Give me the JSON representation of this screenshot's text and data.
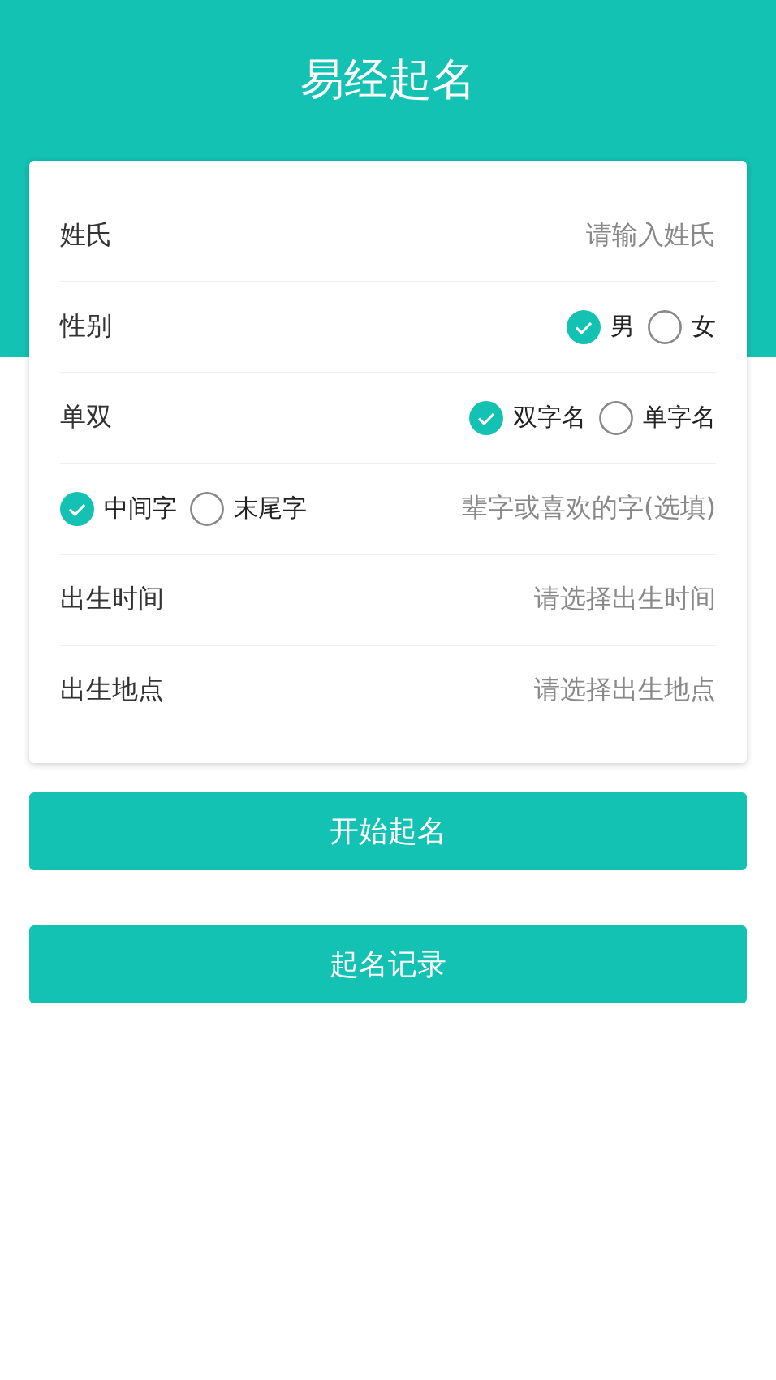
{
  "header": {
    "title": "易经起名"
  },
  "form": {
    "rows": [
      {
        "kind": "input",
        "label": "姓氏",
        "placeholder": "请输入姓氏"
      },
      {
        "kind": "radio",
        "label": "性别",
        "options": [
          {
            "label": "男",
            "selected": true
          },
          {
            "label": "女",
            "selected": false
          }
        ]
      },
      {
        "kind": "radio",
        "label": "单双",
        "options": [
          {
            "label": "双字名",
            "selected": true
          },
          {
            "label": "单字名",
            "selected": false
          }
        ]
      },
      {
        "kind": "radio-input",
        "options": [
          {
            "label": "中间字",
            "selected": true
          },
          {
            "label": "末尾字",
            "selected": false
          }
        ],
        "placeholder": "辈字或喜欢的字(选填)"
      },
      {
        "kind": "picker",
        "label": "出生时间",
        "placeholder": "请选择出生时间"
      },
      {
        "kind": "picker",
        "label": "出生地点",
        "placeholder": "请选择出生地点"
      }
    ]
  },
  "buttons": [
    {
      "label": "开始起名"
    },
    {
      "label": "起名记录"
    }
  ]
}
